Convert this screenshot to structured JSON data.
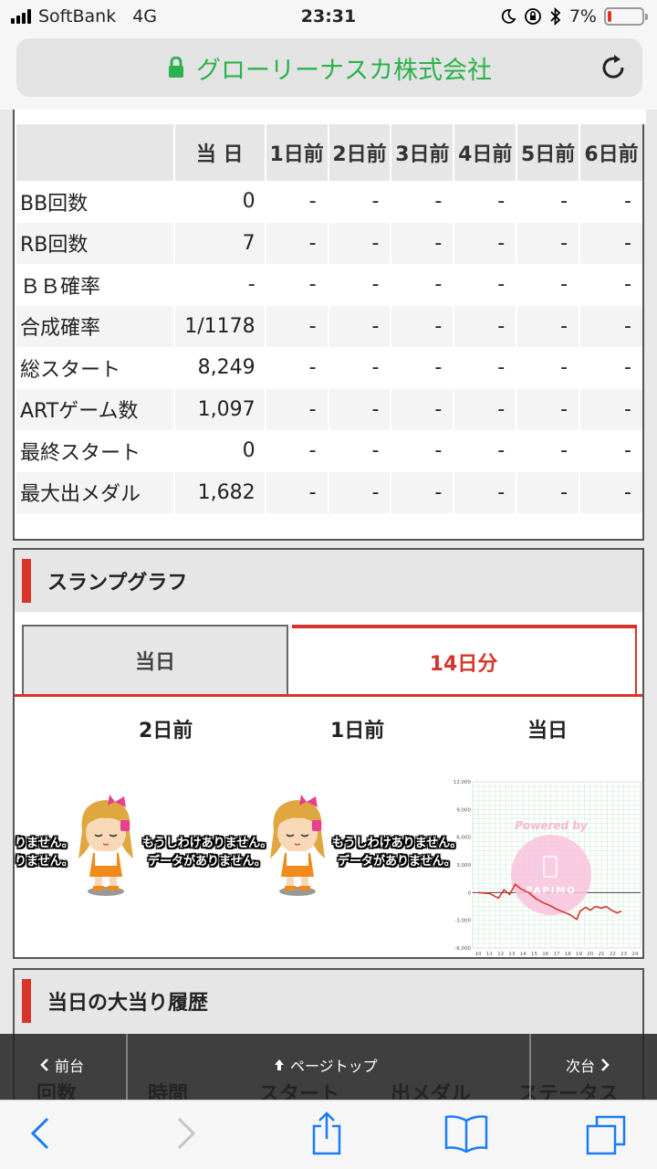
{
  "status_bar": {
    "carrier": "SoftBank",
    "network": "4G",
    "time": "23:31",
    "battery": "7%"
  },
  "address_bar": {
    "site_name": "グローリーナスカ株式会社"
  },
  "stats_table": {
    "columns": [
      "",
      "当 日",
      "1日前",
      "2日前",
      "3日前",
      "4日前",
      "5日前",
      "6日前"
    ],
    "rows": [
      {
        "label": "BB回数",
        "today": "0",
        "history": [
          "-",
          "-",
          "-",
          "-",
          "-",
          "-"
        ]
      },
      {
        "label": "RB回数",
        "today": "7",
        "history": [
          "-",
          "-",
          "-",
          "-",
          "-",
          "-"
        ]
      },
      {
        "label": "ＢＢ確率",
        "today": "-",
        "history": [
          "-",
          "-",
          "-",
          "-",
          "-",
          "-"
        ]
      },
      {
        "label": "合成確率",
        "today": "1/1178",
        "history": [
          "-",
          "-",
          "-",
          "-",
          "-",
          "-"
        ]
      },
      {
        "label": "総スタート",
        "today": "8,249",
        "history": [
          "-",
          "-",
          "-",
          "-",
          "-",
          "-"
        ]
      },
      {
        "label": "ARTゲーム数",
        "today": "1,097",
        "history": [
          "-",
          "-",
          "-",
          "-",
          "-",
          "-"
        ]
      },
      {
        "label": "最終スタート",
        "today": "0",
        "history": [
          "-",
          "-",
          "-",
          "-",
          "-",
          "-"
        ]
      },
      {
        "label": "最大出メダル",
        "today": "1,682",
        "history": [
          "-",
          "-",
          "-",
          "-",
          "-",
          "-"
        ]
      }
    ]
  },
  "slump_section": {
    "title": "スランプグラフ",
    "tabs": {
      "today": "当日",
      "fourteen_days": "14日分"
    },
    "day_labels": {
      "two_days_ago": "2日前",
      "one_day_ago": "1日前",
      "today": "当日"
    },
    "no_data_line1": "もうしわけありません。",
    "no_data_line2": "データがありません。",
    "partial_line1": "りません。",
    "partial_line2": "りません。"
  },
  "slump_graph": {
    "y_ticks": [
      "12,000",
      "9,000",
      "6,000",
      "3,000",
      "0",
      "-3,000",
      "-6,000"
    ],
    "x_ticks": [
      "10",
      "11",
      "12",
      "13",
      "14",
      "15",
      "16",
      "17",
      "18",
      "19",
      "20",
      "21",
      "22",
      "23",
      "24"
    ],
    "watermark_top": "Powered by",
    "watermark_bottom": "PAPIMO",
    "series": [
      [
        10,
        0
      ],
      [
        11,
        -100
      ],
      [
        11.8,
        -600
      ],
      [
        12.3,
        300
      ],
      [
        12.8,
        -200
      ],
      [
        13.3,
        900
      ],
      [
        13.8,
        400
      ],
      [
        14.5,
        0
      ],
      [
        15.2,
        -700
      ],
      [
        15.8,
        -1100
      ],
      [
        16.4,
        -1400
      ],
      [
        17.0,
        -1800
      ],
      [
        17.6,
        -2100
      ],
      [
        18.2,
        -2400
      ],
      [
        18.8,
        -2900
      ],
      [
        19.1,
        -2000
      ],
      [
        19.6,
        -1600
      ],
      [
        20.0,
        -1900
      ],
      [
        20.5,
        -1500
      ],
      [
        21.0,
        -1700
      ],
      [
        21.4,
        -1500
      ],
      [
        21.9,
        -1900
      ],
      [
        22.4,
        -2200
      ],
      [
        22.8,
        -2000
      ]
    ],
    "line_color": "#d8342b"
  },
  "history_section": {
    "title": "当日の大当り履歴",
    "columns": [
      "回数",
      "時間",
      "スタート",
      "出メダル",
      "ステータス"
    ]
  },
  "footer_nav": {
    "prev": "前台",
    "page_top": "ページトップ",
    "next": "次台"
  },
  "colors": {
    "accent_red": "#d8342b",
    "secure_green": "#2bb24c",
    "ios_blue": "#1a7cf5"
  }
}
